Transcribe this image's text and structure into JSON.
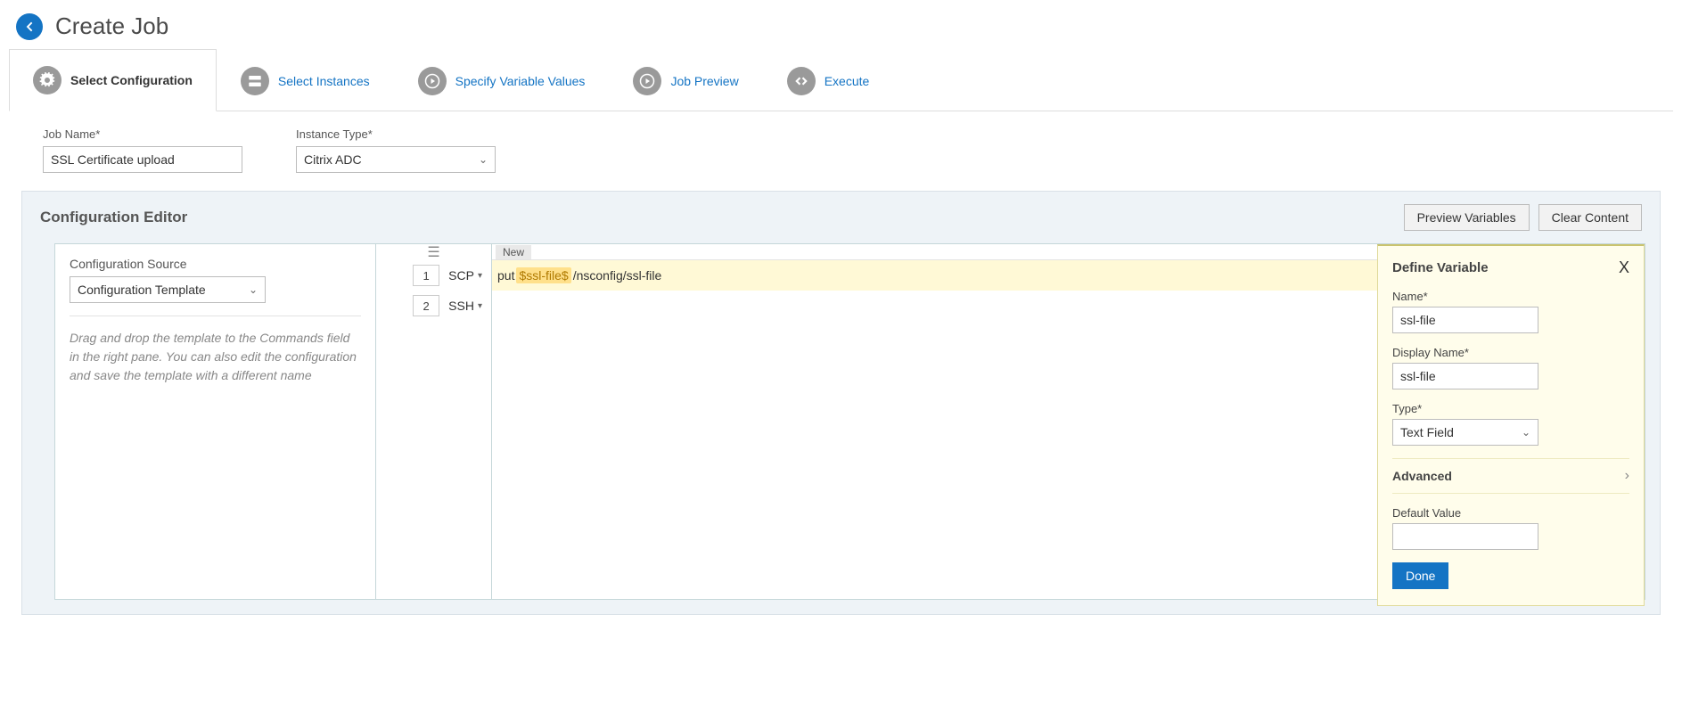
{
  "header": {
    "title": "Create Job"
  },
  "steps": [
    {
      "label": "Select Configuration",
      "active": true,
      "icon": "gear"
    },
    {
      "label": "Select Instances",
      "active": false,
      "icon": "instances"
    },
    {
      "label": "Specify Variable Values",
      "active": false,
      "icon": "play"
    },
    {
      "label": "Job Preview",
      "active": false,
      "icon": "play"
    },
    {
      "label": "Execute",
      "active": false,
      "icon": "code"
    }
  ],
  "form": {
    "job_name_label": "Job Name*",
    "job_name_value": "SSL Certificate upload",
    "instance_type_label": "Instance Type*",
    "instance_type_value": "Citrix ADC"
  },
  "editor": {
    "title": "Configuration Editor",
    "buttons": {
      "preview": "Preview Variables",
      "clear": "Clear Content"
    },
    "source_label": "Configuration Source",
    "source_value": "Configuration Template",
    "help_text": "Drag and drop the template to the Commands field in the right pane. You can also edit the configuration and save the template with a different name",
    "tab_label": "New",
    "lines": [
      {
        "num": "1",
        "proto": "SCP",
        "text_prefix": "put ",
        "var": "$ssl-file$",
        "text_suffix": " /nsconfig/ssl-file",
        "highlight": true
      },
      {
        "num": "2",
        "proto": "SSH",
        "text_prefix": "",
        "var": "",
        "text_suffix": "",
        "highlight": false
      }
    ]
  },
  "popover": {
    "title": "Define Variable",
    "name_label": "Name*",
    "name_value": "ssl-file",
    "display_label": "Display Name*",
    "display_value": "ssl-file",
    "type_label": "Type*",
    "type_value": "Text Field",
    "advanced_label": "Advanced",
    "default_label": "Default Value",
    "default_value": "",
    "done_label": "Done"
  }
}
